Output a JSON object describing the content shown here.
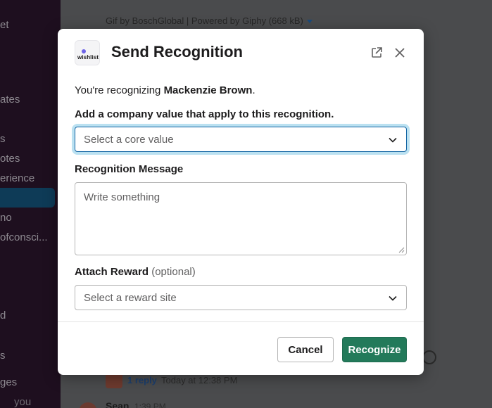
{
  "background": {
    "sidebar_items": [
      "et",
      "ates",
      "s",
      "otes",
      "erience",
      "no",
      "ofconsci...",
      "d",
      "s",
      "ges",
      "you"
    ],
    "gif_caption": "Gif by BoschGlobal | Powered by Giphy (668 kB)",
    "thread": {
      "reply_link": "1 reply",
      "reply_time": "Today at 12:38 PM"
    },
    "next_message": {
      "author": "Sean",
      "time": "1:39 PM"
    }
  },
  "modal": {
    "logo_text": "wishlist",
    "title": "Send Recognition",
    "intro_prefix": "You're recognizing ",
    "recipient": "Mackenzie Brown",
    "intro_suffix": ".",
    "core_value": {
      "label": "Add a company value that apply to this recognition.",
      "placeholder": "Select a core value"
    },
    "message": {
      "label": "Recognition Message",
      "placeholder": "Write something"
    },
    "reward": {
      "label": "Attach Reward",
      "optional_note": "(optional)",
      "placeholder": "Select a reward site"
    },
    "cancel_label": "Cancel",
    "submit_label": "Recognize"
  },
  "colors": {
    "primary_button": "#237a5a",
    "focus_ring": "#1264a3"
  },
  "icons": [
    "open-external-icon",
    "close-icon",
    "chevron-down-icon",
    "resize-grip-icon",
    "add-reaction-icon"
  ]
}
